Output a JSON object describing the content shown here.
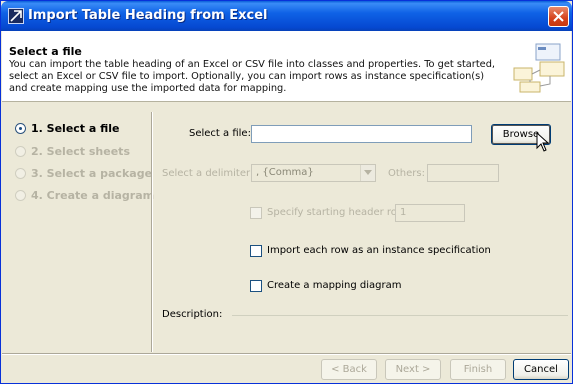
{
  "window": {
    "title": "Import Table Heading from Excel"
  },
  "header": {
    "title": "Select a file",
    "description": "You can import the table heading of an Excel or CSV file into classes and properties. To get started, select an Excel or CSV file to import. Optionally, you can import rows as instance specification(s) and create mapping use the imported data for mapping."
  },
  "steps": [
    {
      "label": "1. Select a file",
      "active": true
    },
    {
      "label": "2. Select sheets",
      "active": false
    },
    {
      "label": "3. Select a package",
      "active": false
    },
    {
      "label": "4. Create a diagram",
      "active": false
    }
  ],
  "form": {
    "file_label": "Select a file:",
    "file_value": "",
    "browse_label": "Browse",
    "delimiter_label": "Select a delimiter:",
    "delimiter_value": ", {Comma}",
    "others_label": "Others:",
    "others_value": "",
    "header_row_label": "Specify starting header row",
    "header_row_value": "1",
    "import_rows_label": "Import each row as an instance specification",
    "mapping_label": "Create a mapping diagram",
    "description_label": "Description:"
  },
  "footer": {
    "back": "< Back",
    "next": "Next >",
    "finish": "Finish",
    "cancel": "Cancel"
  },
  "colors": {
    "titlebar": "#0548d1",
    "dialog_bg": "#ece9d8",
    "close": "#d5421c"
  }
}
